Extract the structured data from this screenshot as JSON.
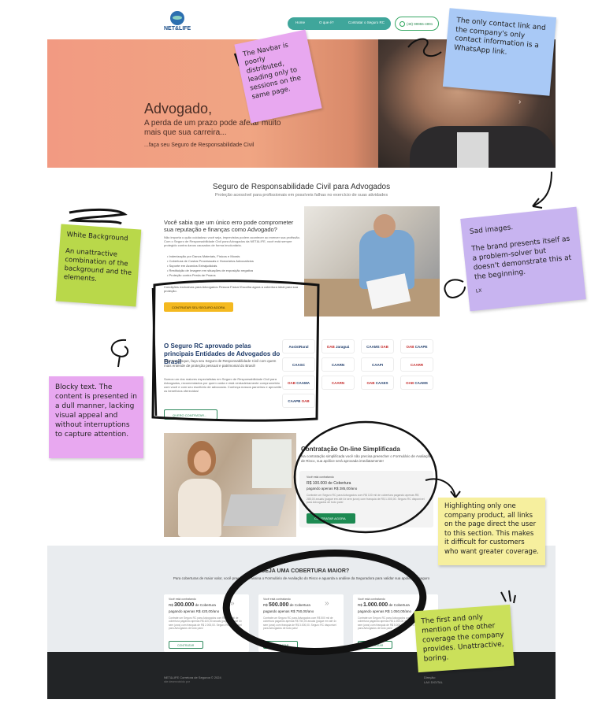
{
  "site": {
    "logo_text": "NET&LIFE",
    "nav": {
      "items": [
        "Home",
        "O que é?",
        "Contratar o Seguro RC"
      ],
      "whatsapp": "(48) 99955-4891"
    },
    "hero": {
      "title": "Advogado,",
      "subtitle": "A perda de um prazo pode afetar muito mais que sua carreira...",
      "note": "...faça seu Seguro de Responsabilidade Civil"
    },
    "section": {
      "title": "Seguro de Responsabilidade Civil para Advogados",
      "subtitle": "Proteção acessível para profissionais em possíveis falhas no exercício de suas atividades"
    },
    "intro": {
      "question": "Você sabia que um único erro pode comprometer sua reputação e finanças como Advogado?",
      "paragraph": "Não importa o quão cuidadoso você seja, imprevistos podem acontecer ao exercer sua profissão. Com o Seguro de Responsabilidade Civil para Advogados da NET&LIFE, você está sempre protegido contra danos causados de forma involuntária.",
      "list": [
        "Indenização por Danos Materiais, Físicos e Morais",
        "Cobertura de Custos Processuais e Honorários Advocatícios",
        "Suporte em Acordos Extrajudiciais",
        "Restituição de Imagem em situações de exposição negativa",
        "Proteção contra Perda de Prazos"
      ],
      "conditions": "Condições exclusivas para Advogados Pessoa Física! Escolha agora a cobertura ideal para sua proteção.",
      "cta": "CONTRATAR SEU SEGURO AGORA"
    },
    "rc": {
      "title": "O Seguro RC aprovado pelas principais Entidades de Advogados do Brasil",
      "p1": "Não se arrisque, faça seu Seguro de Responsabilidade Civil com quem mais entende de proteção pessoal e patrimonial do Brasil!",
      "p2": "Somos um dos maiores especialistas em Seguro de Responsabilidade Civil para Advogados, recomendados por quem cuida e está verdadeiramente comprometido com você e com seu escritório de advocacia. Conheça nossos parceiros e aproveite os benefícios oferecidos!",
      "button": "QUERO CONTRATAR..."
    },
    "partner_logos": [
      {
        "a": "AssistRural",
        "b": ""
      },
      {
        "a": "OAB",
        "b": " Jaraguá"
      },
      {
        "a": "CAAMS",
        "b": " OAB"
      },
      {
        "a": "OAB",
        "b": " CAAPE"
      },
      {
        "a": "CAASC",
        "b": ""
      },
      {
        "a": "CAARN",
        "b": ""
      },
      {
        "a": "CAAPI",
        "b": ""
      },
      {
        "a": "CAARR",
        "b": ""
      },
      {
        "a": "OAB",
        "b": " CAAMA"
      },
      {
        "a": "CAARN",
        "b": ""
      },
      {
        "a": "OAB",
        "b": " CAAES"
      },
      {
        "a": "OAB",
        "b": " CAAMS"
      },
      {
        "a": "CAAPB",
        "b": " OAB"
      }
    ],
    "simplified": {
      "title": "Contratação On-line Simplificada",
      "p": "Na contratação simplificada você não precisa preencher o Formulário de Avaliação de Risco, sua apólice será aprovada imediatamente!",
      "card_label": "Você está contratando",
      "amount": "R$ 100.000 de Cobertura",
      "price": "pagando apenas R$ 285,00/ano",
      "detail": "Contrate um Seguro RC para Advogados com R$ 100 mil de cobertura pagando apenas R$ 285,00 anuais (pague em até 4x sem juros) com franquia de R$ 1.000,00. Seguro RC disponível para Advogados de todo país!",
      "button": "CONTRATAR AGORA"
    },
    "coverage": {
      "title": "DESEJA UMA COBERTURA MAIOR?",
      "p": "Para coberturas de maior valor, você preenche e assina o Formulário de Avaliação do Risco e aguarda a análise da Seguradora para validar sua apólice de seguro",
      "cards": [
        {
          "label": "Você está contratando",
          "prefix": "R$",
          "value": "300.000",
          "suffix": " de Cobertura",
          "price": "pagando apenas R$ 420,00/ano",
          "detail": "Contrate um Seguro RC para Advogados com R$ 300 mil de cobertura pagando apenas R$ 420,00 anuais (pague em até 4x sem juros) com franquia de R$ 2.000,00. Seguro RC disponível para Advogados de todo país!",
          "button": "CONTRATAR"
        },
        {
          "label": "Você está contratando",
          "prefix": "R$",
          "value": "500.000",
          "suffix": " de Cobertura",
          "price": "pagando apenas R$ 750,00/ano",
          "detail": "Contrate um Seguro RC para Advogados com R$ 500 mil de cobertura pagando apenas R$ 750,00 anuais (pague em até 4x sem juros) com franquia de R$ 3.000,00. Seguro RC disponível para Advogados de todo país!",
          "button": "CONTRATAR"
        },
        {
          "label": "Você está contratando",
          "prefix": "R$",
          "value": "1.000.000",
          "suffix": " de Cobertura",
          "price": "pagando apenas R$ 1.050,00/ano",
          "detail": "Contrate um Seguro RC para Advogados com R$ 1 milhão de cobertura pagando apenas R$ 1.050,00 anuais (pague em até 4x sem juros) com franquia de R$ 5.000,00. Seguro RC disponível para Advogados de todo país!",
          "button": "CONTRATAR"
        }
      ]
    },
    "footer": {
      "copyright": "NET&LIFE Corretora de Seguros © 2024",
      "developer": "site desenvolvido por",
      "right1": "Direção:",
      "right2": "LAX DIGITAL"
    }
  },
  "annotations": {
    "navbar": "The Navbar is poorly distributed, leading only to sessions on the same page.",
    "contact": "The only contact link and the company's only contact information is a WhatsApp link.",
    "white_bg": "White Background",
    "white_bg_body": "An unattractive combination of the background and the elements.",
    "sad_images_title": "Sad images.",
    "sad_images_body": "The brand presents itself as a problem-solver but doesn't demonstrate this at the beginning.",
    "sad_images_sig": "LX",
    "blocky": "Blocky text. The content is presented in a dull manner, lacking visual appeal and without interruptions to capture attention.",
    "highlight": "Highlighting only one company product, all links on the page direct the user to this section. This makes it difficult for customers who want greater coverage.",
    "first_only": "The first and only mention of the other coverage the company provides. Unattractive, boring."
  },
  "colors": {
    "teal_nav": "#3fa69b",
    "cta_yellow": "#f4b920",
    "cta_green": "#1d8a52",
    "note_pink": "#e8a8f0",
    "note_blue": "#a9c9f6",
    "note_green": "#b9d84a",
    "note_purple": "#c8b4f0",
    "note_yellow": "#f6ef9e",
    "note_lime": "#cbe05a"
  }
}
